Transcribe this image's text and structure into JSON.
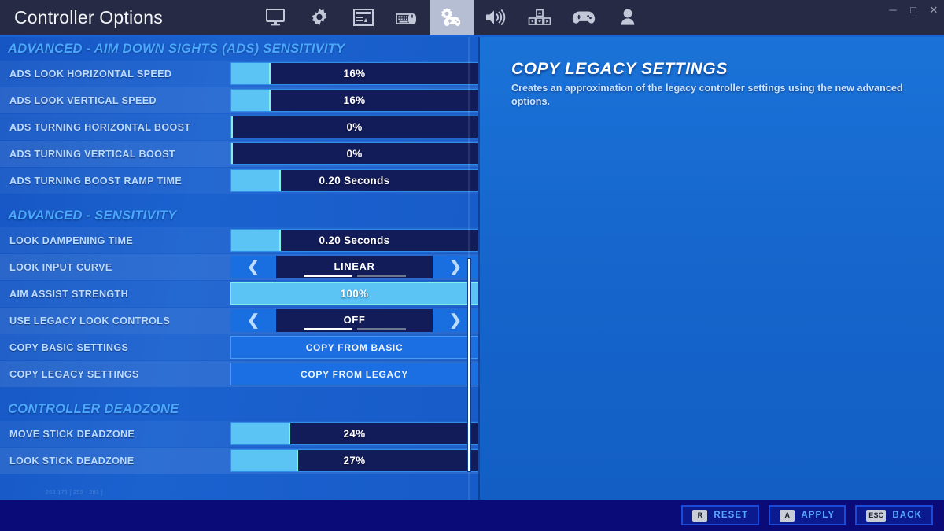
{
  "window": {
    "title": "Controller Options",
    "controls": [
      {
        "name": "minimize",
        "glyph": "─"
      },
      {
        "name": "maximize",
        "glyph": "□"
      },
      {
        "name": "close",
        "glyph": "✕"
      }
    ]
  },
  "tabs": [
    {
      "icon": "monitor-icon",
      "label": "Video",
      "selected": false
    },
    {
      "icon": "gear-icon",
      "label": "Game",
      "selected": false
    },
    {
      "icon": "hud-layout-icon",
      "label": "Brightness",
      "selected": false
    },
    {
      "icon": "keyboard-mouse-icon",
      "label": "Keyboard Controls",
      "selected": false
    },
    {
      "icon": "controller-options-icon",
      "label": "Controller Options",
      "selected": true
    },
    {
      "icon": "speaker-icon",
      "label": "Audio",
      "selected": false
    },
    {
      "icon": "input-pad-icon",
      "label": "Accessibility",
      "selected": false
    },
    {
      "icon": "gamepad-icon",
      "label": "Controller Config",
      "selected": false
    },
    {
      "icon": "account-icon",
      "label": "Account",
      "selected": false
    }
  ],
  "sections": [
    {
      "title": "ADVANCED - AIM DOWN SIGHTS (ADS) SENSITIVITY",
      "rows": [
        {
          "label": "ADS LOOK HORIZONTAL SPEED",
          "type": "slider",
          "value": "16%",
          "fill_pct": 16
        },
        {
          "label": "ADS LOOK VERTICAL SPEED",
          "type": "slider",
          "value": "16%",
          "fill_pct": 16
        },
        {
          "label": "ADS TURNING HORIZONTAL BOOST",
          "type": "slider",
          "value": "0%",
          "fill_pct": 0
        },
        {
          "label": "ADS TURNING VERTICAL BOOST",
          "type": "slider",
          "value": "0%",
          "fill_pct": 0
        },
        {
          "label": "ADS TURNING BOOST RAMP TIME",
          "type": "slider",
          "value": "0.20 Seconds",
          "fill_pct": 20
        }
      ]
    },
    {
      "title": "ADVANCED - SENSITIVITY",
      "rows": [
        {
          "label": "LOOK DAMPENING TIME",
          "type": "slider",
          "value": "0.20 Seconds",
          "fill_pct": 20
        },
        {
          "label": "LOOK INPUT CURVE",
          "type": "selector",
          "value": "LINEAR",
          "left_arrow": "❮",
          "right_arrow": "❯",
          "pages": 2,
          "page_index": 0
        },
        {
          "label": "AIM ASSIST STRENGTH",
          "type": "slider-full",
          "value": "100%",
          "fill_pct": 100
        },
        {
          "label": "USE LEGACY LOOK CONTROLS",
          "type": "selector",
          "value": "OFF",
          "left_arrow": "❮",
          "right_arrow": "❯",
          "pages": 2,
          "page_index": 0
        },
        {
          "label": "COPY BASIC SETTINGS",
          "type": "button",
          "value": "COPY FROM BASIC"
        },
        {
          "label": "COPY LEGACY SETTINGS",
          "type": "button",
          "value": "COPY FROM LEGACY"
        }
      ]
    },
    {
      "title": "CONTROLLER DEADZONE",
      "rows": [
        {
          "label": "MOVE STICK DEADZONE",
          "type": "slider",
          "value": "24%",
          "fill_pct": 24
        },
        {
          "label": "LOOK STICK DEADZONE",
          "type": "slider",
          "value": "27%",
          "fill_pct": 27
        }
      ]
    }
  ],
  "description": {
    "title": "COPY LEGACY SETTINGS",
    "body": "Creates an approximation of the legacy controller settings using the new advanced options."
  },
  "watermark": "268 175 [ 259 - 281 ]",
  "actions": [
    {
      "key": "R",
      "label": "RESET"
    },
    {
      "key": "A",
      "label": "APPLY"
    },
    {
      "key": "ESC",
      "label": "BACK"
    }
  ],
  "colors": {
    "accent_blue": "#1763d6",
    "slider_fill": "#5cc3f5",
    "slider_edge": "#7ef0e6",
    "label_text": "#bcdcff",
    "section_heading": "#4aa8ff",
    "titlebar": "#262a45",
    "bottom_bar": "#0a0a78",
    "action_text": "#59a8ff"
  }
}
